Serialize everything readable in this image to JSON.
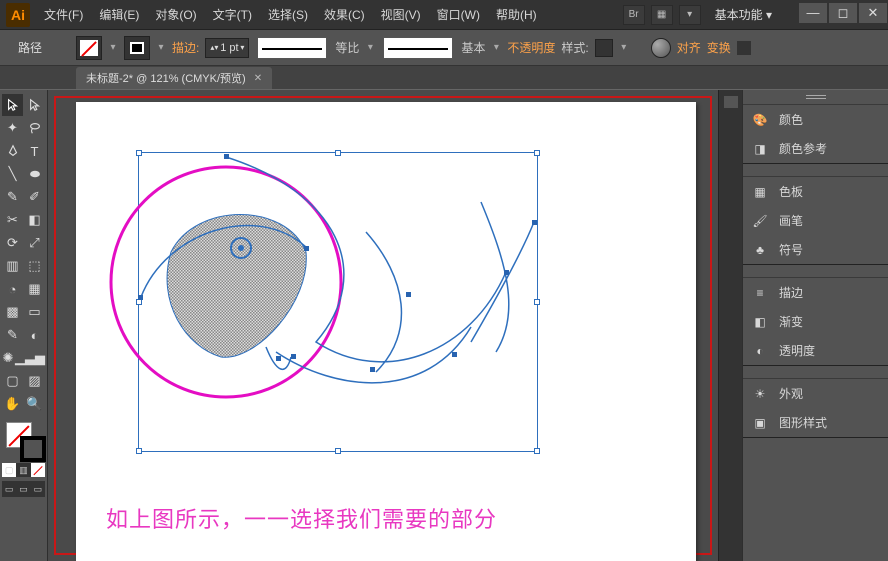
{
  "app": {
    "logo": "Ai"
  },
  "menu": {
    "items": [
      "文件(F)",
      "编辑(E)",
      "对象(O)",
      "文字(T)",
      "选择(S)",
      "效果(C)",
      "视图(V)",
      "窗口(W)",
      "帮助(H)"
    ]
  },
  "workspace_switcher": "基本功能",
  "controlbar": {
    "tool_label": "路径",
    "stroke_label": "描边:",
    "stroke_value": "1 pt",
    "proportion_label": "等比",
    "profile_label": "基本",
    "opacity_label": "不透明度",
    "style_label": "样式:",
    "align_label": "对齐",
    "transform_label": "变换"
  },
  "document": {
    "tab_label": "未标题-2* @ 121% (CMYK/预览)"
  },
  "canvas": {
    "caption": "如上图所示，一一选择我们需要的部分"
  },
  "right_panels": {
    "items": [
      {
        "icon": "palette",
        "label": "颜色"
      },
      {
        "icon": "guide",
        "label": "颜色参考"
      },
      {
        "icon": "swatches",
        "label": "色板"
      },
      {
        "icon": "brush",
        "label": "画笔"
      },
      {
        "icon": "symbols",
        "label": "符号"
      },
      {
        "icon": "stroke",
        "label": "描边"
      },
      {
        "icon": "gradient",
        "label": "渐变"
      },
      {
        "icon": "opacity",
        "label": "透明度"
      },
      {
        "icon": "appear",
        "label": "外观"
      },
      {
        "icon": "gstyle",
        "label": "图形样式"
      }
    ]
  }
}
